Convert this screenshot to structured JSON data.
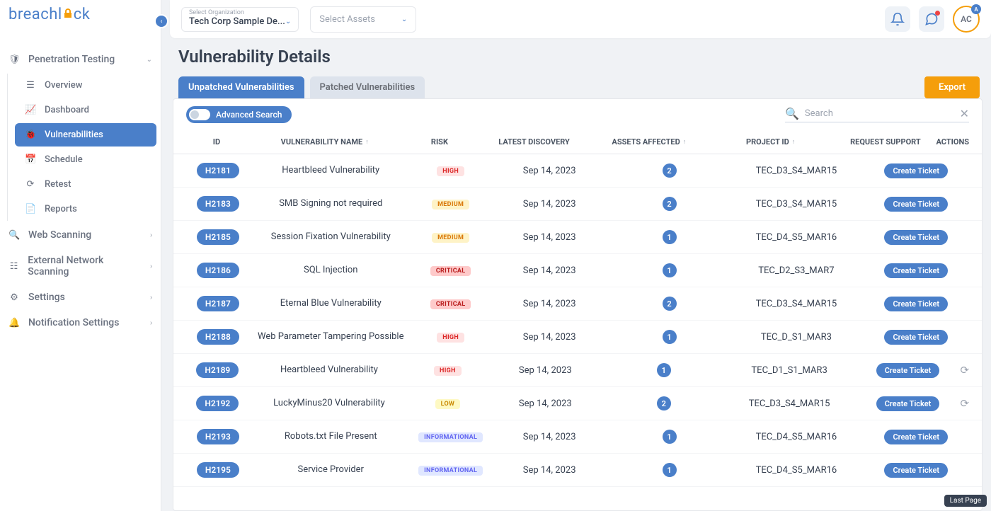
{
  "brand": {
    "name_a": "breachl",
    "name_b": "ck"
  },
  "topbar": {
    "org_label": "Select Organization",
    "org_value": "Tech Corp Sample De...",
    "assets_placeholder": "Select Assets",
    "avatar_initials": "AC",
    "avatar_badge": "A"
  },
  "sidebar": {
    "main": "Penetration Testing",
    "sub": [
      "Overview",
      "Dashboard",
      "Vulnerabilities",
      "Schedule",
      "Retest",
      "Reports"
    ],
    "other": [
      "Web Scanning",
      "External Network Scanning",
      "Settings",
      "Notification Settings"
    ]
  },
  "page": {
    "title": "Vulnerability Details"
  },
  "tabs": {
    "active": "Unpatched Vulnerabilities",
    "inactive": "Patched Vulnerabilities"
  },
  "buttons": {
    "export": "Export",
    "adv_search": "Advanced Search",
    "create_ticket": "Create Ticket"
  },
  "search": {
    "placeholder": "Search"
  },
  "columns": {
    "id": "ID",
    "name": "VULNERABILITY NAME",
    "risk": "RISK",
    "date": "LATEST DISCOVERY",
    "assets": "ASSETS AFFECTED",
    "pid": "PROJECT ID",
    "req": "REQUEST SUPPORT",
    "act": "ACTIONS"
  },
  "risk_labels": {
    "HIGH": "HIGH",
    "MEDIUM": "MEDIUM",
    "CRITICAL": "CRITICAL",
    "LOW": "LOW",
    "INFORMATIONAL": "INFORMATIONAL"
  },
  "rows": [
    {
      "id": "H2181",
      "name": "Heartbleed Vulnerability",
      "risk": "HIGH",
      "date": "Sep 14, 2023",
      "assets": 2,
      "pid": "TEC_D3_S4_MAR15",
      "retry": false
    },
    {
      "id": "H2183",
      "name": "SMB Signing not required",
      "risk": "MEDIUM",
      "date": "Sep 14, 2023",
      "assets": 2,
      "pid": "TEC_D3_S4_MAR15",
      "retry": false
    },
    {
      "id": "H2185",
      "name": "Session Fixation Vulnerability",
      "risk": "MEDIUM",
      "date": "Sep 14, 2023",
      "assets": 1,
      "pid": "TEC_D4_S5_MAR16",
      "retry": false
    },
    {
      "id": "H2186",
      "name": "SQL Injection",
      "risk": "CRITICAL",
      "date": "Sep 14, 2023",
      "assets": 1,
      "pid": "TEC_D2_S3_MAR7",
      "retry": false
    },
    {
      "id": "H2187",
      "name": "Eternal Blue Vulnerability",
      "risk": "CRITICAL",
      "date": "Sep 14, 2023",
      "assets": 2,
      "pid": "TEC_D3_S4_MAR15",
      "retry": false
    },
    {
      "id": "H2188",
      "name": "Web Parameter Tampering Possible",
      "risk": "HIGH",
      "date": "Sep 14, 2023",
      "assets": 1,
      "pid": "TEC_D_S1_MAR3",
      "retry": false
    },
    {
      "id": "H2189",
      "name": "Heartbleed Vulnerability",
      "risk": "HIGH",
      "date": "Sep 14, 2023",
      "assets": 1,
      "pid": "TEC_D1_S1_MAR3",
      "retry": true
    },
    {
      "id": "H2192",
      "name": "LuckyMinus20 Vulnerability",
      "risk": "LOW",
      "date": "Sep 14, 2023",
      "assets": 2,
      "pid": "TEC_D3_S4_MAR15",
      "retry": true
    },
    {
      "id": "H2193",
      "name": "Robots.txt File Present",
      "risk": "INFORMATIONAL",
      "date": "Sep 14, 2023",
      "assets": 1,
      "pid": "TEC_D4_S5_MAR16",
      "retry": false
    },
    {
      "id": "H2195",
      "name": "Service Provider",
      "risk": "INFORMATIONAL",
      "date": "Sep 14, 2023",
      "assets": 1,
      "pid": "TEC_D4_S5_MAR16",
      "retry": false
    }
  ],
  "tooltip": {
    "last_page": "Last Page"
  }
}
